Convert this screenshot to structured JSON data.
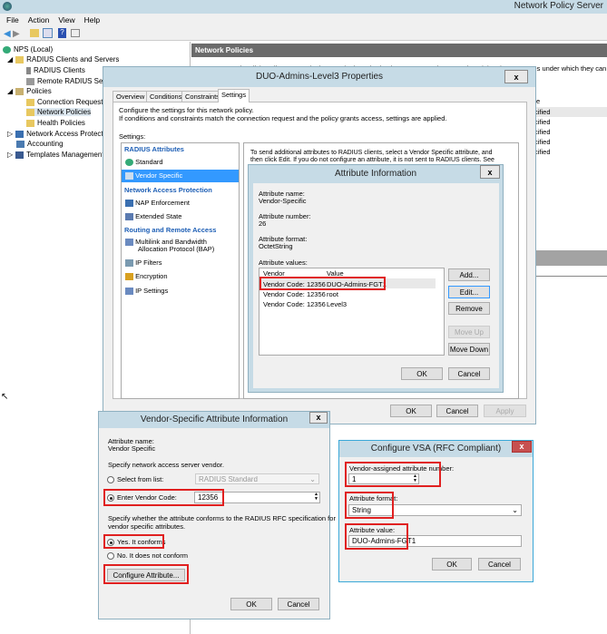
{
  "app": {
    "title": "Network Policy Server",
    "menu": [
      "File",
      "Action",
      "View",
      "Help"
    ]
  },
  "tree": {
    "items": [
      "NPS (Local)",
      "RADIUS Clients and Servers",
      "RADIUS Clients",
      "Remote RADIUS Serve",
      "Policies",
      "Connection Request P",
      "Network Policies",
      "Health Policies",
      "Network Access Protectio",
      "Accounting",
      "Templates Management"
    ]
  },
  "right": {
    "header": "Network Policies",
    "description": "Network policies allow you to designate who is authorized to connect to the network and the circumstances under which they can or cannot",
    "col": "e",
    "rows": [
      "cified",
      "cified",
      "cified",
      "cified",
      "cified"
    ]
  },
  "props": {
    "title": "DUO-Admins-Level3 Properties",
    "close": "x",
    "tabs": [
      "Overview",
      "Conditions",
      "Constraints",
      "Settings"
    ],
    "intro1": "Configure the settings for this network policy.",
    "intro2": "If conditions and constraints match the connection request and the policy grants access, settings are applied.",
    "settings_label": "Settings:",
    "list": [
      {
        "type": "header",
        "label": "RADIUS Attributes"
      },
      {
        "type": "item",
        "label": "Standard"
      },
      {
        "type": "item",
        "label": "Vendor Specific",
        "selected": true
      },
      {
        "type": "header",
        "label": "Network Access Protection"
      },
      {
        "type": "item",
        "label": "NAP Enforcement"
      },
      {
        "type": "item",
        "label": "Extended State"
      },
      {
        "type": "header",
        "label": "Routing and Remote Access"
      },
      {
        "type": "item",
        "label": "Multilink and Bandwidth"
      },
      {
        "type": "item",
        "label": "Allocation Protocol (BAP)"
      },
      {
        "type": "item",
        "label": "IP Filters"
      },
      {
        "type": "item",
        "label": "Encryption"
      },
      {
        "type": "item",
        "label": "IP Settings"
      }
    ],
    "right_text1": "To send additional attributes to RADIUS clients, select a Vendor Specific attribute, and",
    "right_text2": "then click Edit. If you do not configure an attribute, it is not sent to RADIUS clients. See",
    "ok": "OK",
    "cancel": "Cancel",
    "apply": "Apply"
  },
  "attr": {
    "title": "Attribute Information",
    "close": "x",
    "name_label": "Attribute name:",
    "name": "Vendor-Specific",
    "number_label": "Attribute number:",
    "number": "26",
    "format_label": "Attribute format:",
    "format": "OctetString",
    "values_label": "Attribute values:",
    "columns": [
      "Vendor",
      "Value"
    ],
    "rows": [
      {
        "vendor": "Vendor Code: 12356",
        "value": "DUO-Admins-FGT1"
      },
      {
        "vendor": "Vendor Code: 12356",
        "value": "root"
      },
      {
        "vendor": "Vendor Code: 12356",
        "value": "Level3"
      }
    ],
    "add": "Add...",
    "edit": "Edit...",
    "remove": "Remove",
    "move_up": "Move Up",
    "move_down": "Move Down",
    "ok": "OK",
    "cancel": "Cancel"
  },
  "vsa": {
    "title": "Vendor-Specific Attribute Information",
    "close": "x",
    "name_label": "Attribute name:",
    "name": "Vendor Specific",
    "specify": "Specify network access server vendor.",
    "select_from_list": "Select from list:",
    "list_value": "RADIUS Standard",
    "enter_code": "Enter Vendor Code:",
    "code": "12356",
    "conform_text1": "Specify whether the attribute conforms to the RADIUS RFC specification for",
    "conform_text2": "vendor specific attributes.",
    "yes": "Yes. It conforms",
    "no": "No. It does not conform",
    "configure": "Configure Attribute...",
    "ok": "OK",
    "cancel": "Cancel"
  },
  "cfg": {
    "title": "Configure VSA (RFC Compliant)",
    "close": "x",
    "number_label": "Vendor-assigned attribute number:",
    "number": "1",
    "format_label": "Attribute format:",
    "format": "String",
    "value_label": "Attribute value:",
    "value": "DUO-Admins-FGT1",
    "ok": "OK",
    "cancel": "Cancel"
  },
  "colors": {
    "titlebar": "#c6dbe6",
    "highlight": "#e02020",
    "selection": "#3399ff",
    "close_red": "#c75050"
  }
}
